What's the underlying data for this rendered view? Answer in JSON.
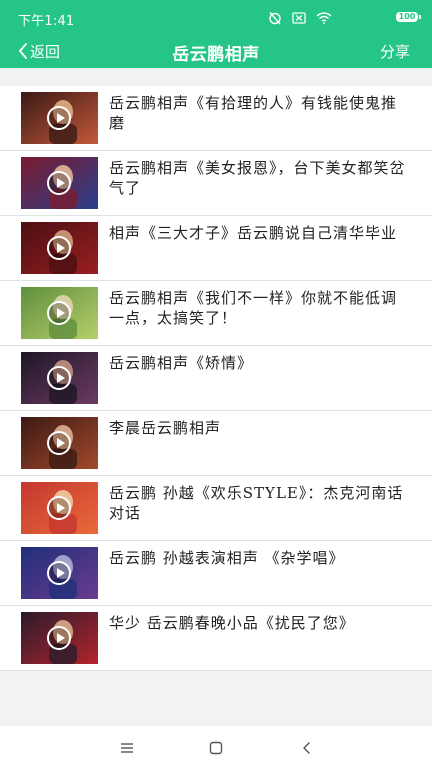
{
  "status_bar": {
    "time": "下午1:41",
    "battery": "100"
  },
  "header": {
    "back_label": "返回",
    "title": "岳云鹏相声",
    "share_label": "分享"
  },
  "colors": {
    "accent": "#24c586"
  },
  "videos": [
    {
      "title": "岳云鹏相声《有拾理的人》有钱能使鬼推磨",
      "thumb_colors": [
        "#3a1a16",
        "#c55a3a",
        "#e7b48a"
      ]
    },
    {
      "title": "岳云鹏相声《美女报恩》，台下美女都笑岔气了",
      "thumb_colors": [
        "#7a1b2e",
        "#2b3f8c",
        "#e7c0a0"
      ]
    },
    {
      "title": "相声《三大才子》岳云鹏说自己清华毕业",
      "thumb_colors": [
        "#4a0f12",
        "#9a1f22",
        "#d6a680"
      ]
    },
    {
      "title": "岳云鹏相声《我们不一样》你就不能低调一点，太搞笑了！",
      "thumb_colors": [
        "#5f8f3e",
        "#b7cf6a",
        "#e6d6b5"
      ]
    },
    {
      "title": "岳云鹏相声《矫情》",
      "thumb_colors": [
        "#1e1726",
        "#6b3a64",
        "#c89a88"
      ]
    },
    {
      "title": "李晨岳云鹏相声",
      "thumb_colors": [
        "#3b1a14",
        "#a24a2b",
        "#e5b99a"
      ]
    },
    {
      "title": "岳云鹏 孙越《欢乐STYLE》：杰克河南话对话",
      "thumb_colors": [
        "#c4372e",
        "#e96a3b",
        "#f2d1a8"
      ]
    },
    {
      "title": "岳云鹏 孙越表演相声 《杂学唱》",
      "thumb_colors": [
        "#1f2f7a",
        "#6b3b8f",
        "#b0b5d8"
      ]
    },
    {
      "title": "华少 岳云鹏春晚小品《扰民了您》",
      "thumb_colors": [
        "#2b1b2c",
        "#b3242b",
        "#e0b58e"
      ]
    }
  ],
  "nav": {
    "icons": [
      "menu-icon",
      "home-icon",
      "back-icon"
    ]
  }
}
